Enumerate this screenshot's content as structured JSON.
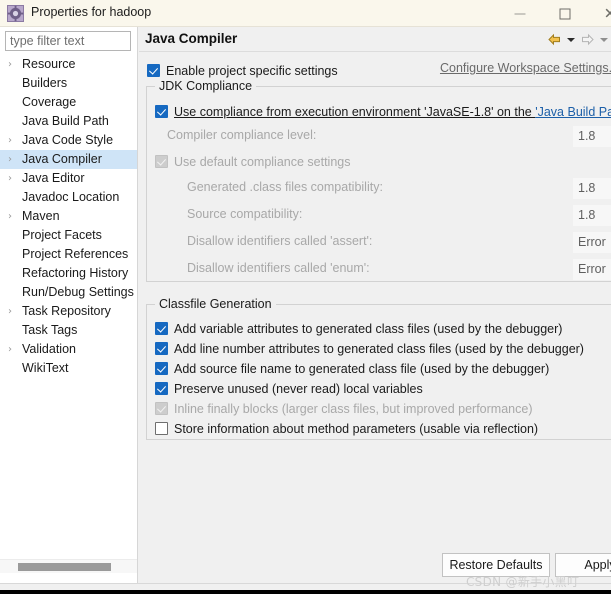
{
  "window": {
    "title": "Properties for hadoop",
    "icon": "properties-icon",
    "controls": {
      "minimize": "—",
      "maximize": "□",
      "close": "✕"
    }
  },
  "sidebar": {
    "filter": {
      "placeholder": "type filter text",
      "value": ""
    },
    "items": [
      {
        "label": "Resource",
        "expandable": true,
        "selected": false
      },
      {
        "label": "Builders",
        "expandable": false,
        "selected": false
      },
      {
        "label": "Coverage",
        "expandable": false,
        "selected": false
      },
      {
        "label": "Java Build Path",
        "expandable": false,
        "selected": false
      },
      {
        "label": "Java Code Style",
        "expandable": true,
        "selected": false
      },
      {
        "label": "Java Compiler",
        "expandable": true,
        "selected": true
      },
      {
        "label": "Java Editor",
        "expandable": true,
        "selected": false
      },
      {
        "label": "Javadoc Location",
        "expandable": false,
        "selected": false
      },
      {
        "label": "Maven",
        "expandable": true,
        "selected": false
      },
      {
        "label": "Project Facets",
        "expandable": false,
        "selected": false
      },
      {
        "label": "Project References",
        "expandable": false,
        "selected": false
      },
      {
        "label": "Refactoring History",
        "expandable": false,
        "selected": false
      },
      {
        "label": "Run/Debug Settings",
        "expandable": false,
        "selected": false
      },
      {
        "label": "Task Repository",
        "expandable": true,
        "selected": false
      },
      {
        "label": "Task Tags",
        "expandable": false,
        "selected": false
      },
      {
        "label": "Validation",
        "expandable": true,
        "selected": false
      },
      {
        "label": "WikiText",
        "expandable": false,
        "selected": false
      }
    ]
  },
  "page": {
    "title": "Java Compiler",
    "nav": {
      "back_icon": "back-arrow-icon",
      "back_menu_icon": "chevron-down-icon",
      "forward_icon": "forward-arrow-icon",
      "forward_menu_icon": "chevron-down-icon"
    },
    "enable_project_specific": {
      "label": "Enable project specific settings",
      "checked": true
    },
    "workspace_link": "Configure Workspace Settings...",
    "jdk_compliance": {
      "legend": "JDK Compliance",
      "use_execution_env": {
        "label_before": "Use compliance from execution environment 'JavaSE-1.8' on the ",
        "link_text": "'Java Build Path'",
        "checked": true
      },
      "compliance_level": {
        "label": "Compiler compliance level:",
        "value": "1.8",
        "enabled": false
      },
      "use_default": {
        "label": "Use default compliance settings",
        "checked": true,
        "enabled": false
      },
      "rows": [
        {
          "label": "Generated .class files compatibility:",
          "value": "1.8"
        },
        {
          "label": "Source compatibility:",
          "value": "1.8"
        },
        {
          "label": "Disallow identifiers called 'assert':",
          "value": "Error"
        },
        {
          "label": "Disallow identifiers called 'enum':",
          "value": "Error"
        }
      ]
    },
    "classfile_generation": {
      "legend": "Classfile Generation",
      "options": [
        {
          "label": "Add variable attributes to generated class files (used by the debugger)",
          "checked": true,
          "enabled": true
        },
        {
          "label": "Add line number attributes to generated class files (used by the debugger)",
          "checked": true,
          "enabled": true
        },
        {
          "label": "Add source file name to generated class file (used by the debugger)",
          "checked": true,
          "enabled": true
        },
        {
          "label": "Preserve unused (never read) local variables",
          "checked": true,
          "enabled": true
        },
        {
          "label": "Inline finally blocks (larger class files, but improved performance)",
          "checked": true,
          "enabled": false
        },
        {
          "label": "Store information about method parameters (usable via reflection)",
          "checked": false,
          "enabled": true
        }
      ]
    }
  },
  "buttons": {
    "restore_defaults": "Restore Defaults",
    "apply": "Apply"
  },
  "watermark": "CSDN @新手小黑叮",
  "colors": {
    "accent_checkbox": "#1669c1",
    "selection": "#cfe4f7",
    "titlebar": "#faf7ec",
    "link": "#1c5fa8"
  }
}
